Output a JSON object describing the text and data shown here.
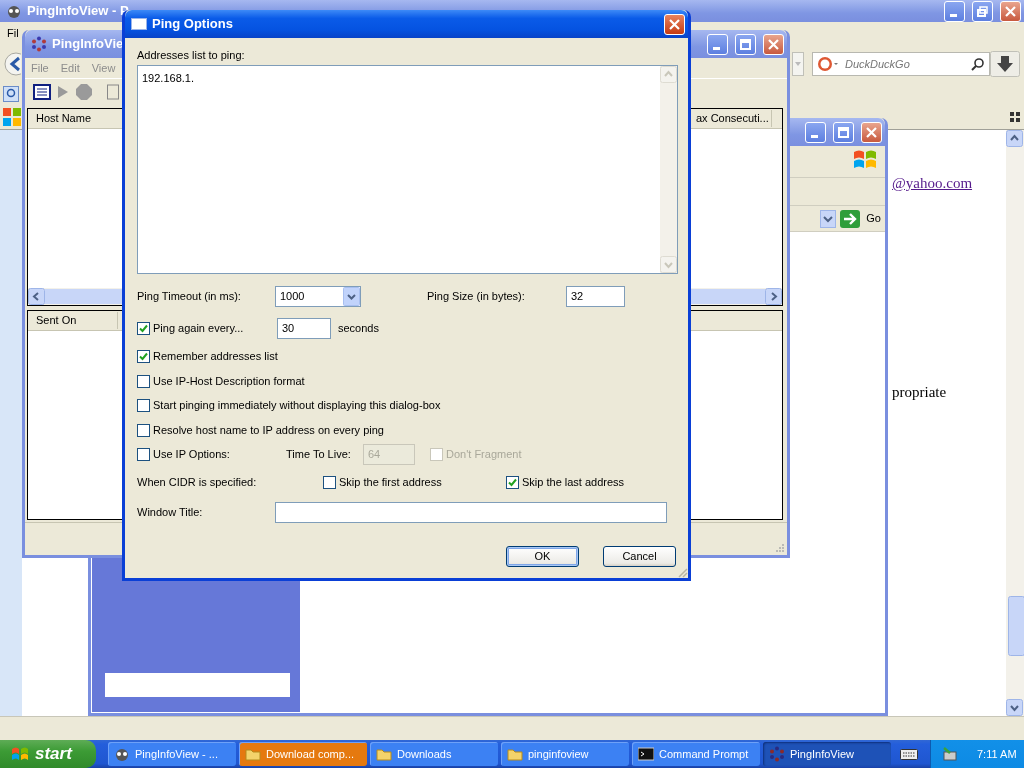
{
  "browser": {
    "title": "PingInfoView - P",
    "menu": [
      "Fil"
    ],
    "search": {
      "placeholder": "DuckDuckGo"
    },
    "page_texts": [
      {
        "kind": "link",
        "text": "@yahoo.com"
      },
      {
        "kind": "text",
        "text": "propriate"
      }
    ]
  },
  "back_window": {
    "go_button": "Go"
  },
  "main_window": {
    "title": "PingInfoVie",
    "menu": [
      "File",
      "Edit",
      "View"
    ],
    "top_columns": [
      "Host Name",
      "ax Consecuti..."
    ],
    "bottom_columns": [
      "Sent On"
    ]
  },
  "dialog": {
    "title": "Ping Options",
    "addresses_label": "Addresses list to ping:",
    "addresses_value": "192.168.1.",
    "timeout": {
      "label": "Ping Timeout (in ms):",
      "value": "1000"
    },
    "size": {
      "label": "Ping Size (in bytes):",
      "value": "32"
    },
    "ping_again": {
      "label": "Ping again every...",
      "checked": true,
      "value": "30",
      "unit": "seconds"
    },
    "options": [
      {
        "label": "Remember addresses list",
        "checked": true
      },
      {
        "label": "Use IP-Host Description format",
        "checked": false
      },
      {
        "label": "Start pinging immediately without displaying this dialog-box",
        "checked": false
      },
      {
        "label": "Resolve host name to IP address on every ping",
        "checked": false
      }
    ],
    "ip_options": {
      "label": "Use IP Options:",
      "checked": false,
      "ttl_label": "Time To Live:",
      "ttl_value": "64",
      "disabled": true,
      "dont_fragment": {
        "label": "Don't Fragment",
        "checked": false
      }
    },
    "cidr": {
      "label": "When CIDR is specified:",
      "options": [
        {
          "label": "Skip the first address",
          "checked": false
        },
        {
          "label": "Skip the last address",
          "checked": true
        }
      ]
    },
    "window_title_label": "Window Title:",
    "buttons": [
      {
        "label": "OK",
        "default": true
      },
      {
        "label": "Cancel",
        "default": false
      }
    ]
  },
  "taskbar": {
    "start": "start",
    "items": [
      {
        "label": "PingInfoView - ...",
        "kind": "app",
        "selected": false,
        "flashing": false
      },
      {
        "label": "Download comp...",
        "kind": "folder",
        "selected": false,
        "flashing": true
      },
      {
        "label": "Downloads",
        "kind": "folder",
        "selected": false,
        "flashing": false
      },
      {
        "label": "pinginfoview",
        "kind": "folder",
        "selected": false,
        "flashing": false
      },
      {
        "label": "Command Prompt",
        "kind": "console",
        "selected": false,
        "flashing": false
      },
      {
        "label": "PingInfoView",
        "kind": "dots",
        "selected": true,
        "flashing": false
      }
    ],
    "clock": "7:11 AM"
  }
}
